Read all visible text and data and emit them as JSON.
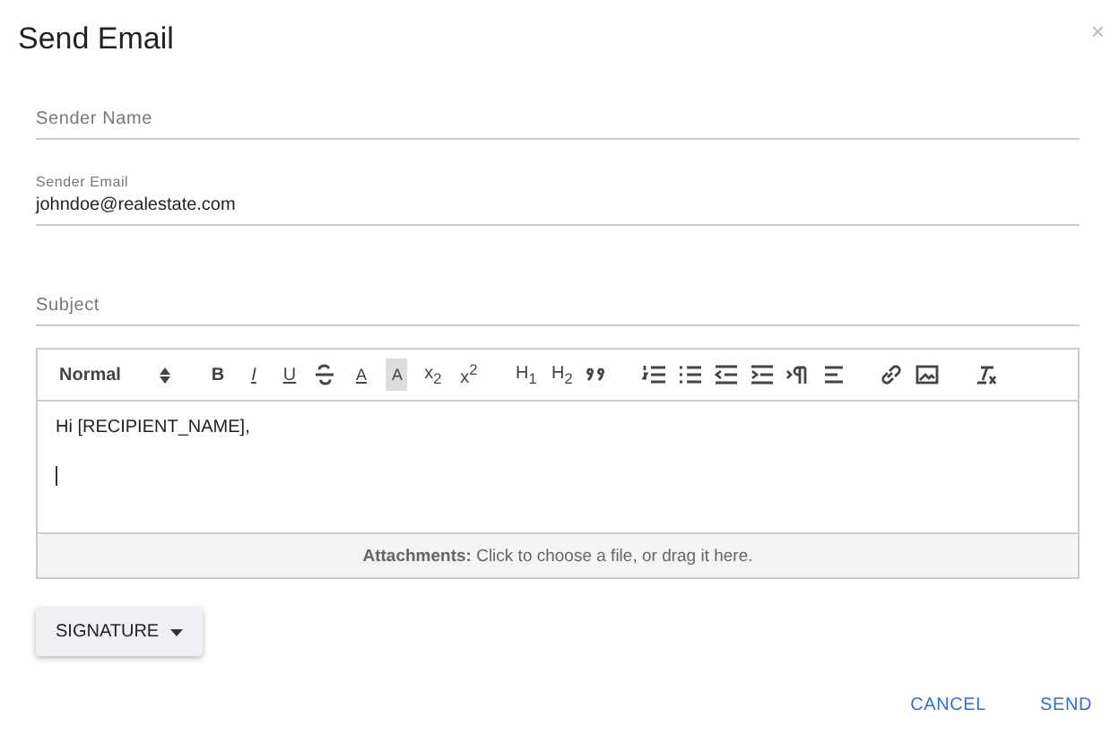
{
  "dialog": {
    "title": "Send Email",
    "close": "×"
  },
  "fields": [
    {
      "label": "Sender Name"
    },
    {
      "label": "Sender Email",
      "value": "johndoe@realestate.com"
    },
    {
      "label": "Subject"
    }
  ],
  "editor": {
    "format": "Normal",
    "toolbar": [
      [
        {
          "kind": "bold",
          "label": "B"
        },
        {
          "kind": "italic",
          "label": "I"
        },
        {
          "kind": "underline",
          "label": "U"
        },
        {
          "kind": "strike"
        },
        {
          "kind": "color",
          "label": "A"
        },
        {
          "kind": "background",
          "label": "A"
        },
        {
          "kind": "plain",
          "label": "x$_{2}$"
        },
        {
          "kind": "plain",
          "label": "x$^{2}$"
        }
      ],
      [
        {
          "kind": "plain",
          "label": "H$_{1}$"
        },
        {
          "kind": "plain",
          "label": "H$_{2}$"
        },
        {
          "kind": "quote"
        }
      ],
      [
        {
          "kind": "ordered-list"
        },
        {
          "kind": "bullet-list"
        },
        {
          "kind": "outdent"
        },
        {
          "kind": "indent"
        },
        {
          "kind": "direction"
        },
        {
          "kind": "align"
        }
      ],
      [
        {
          "kind": "link"
        },
        {
          "kind": "image"
        }
      ],
      [
        {
          "kind": "clean"
        }
      ]
    ],
    "body": [
      "Hi [RECIPIENT_NAME],"
    ],
    "attachments": "**Attachments:** Click to choose a file, or drag it here."
  },
  "signature_button": "SIGNATURE",
  "buttons": [
    "CANCEL",
    "SEND"
  ]
}
